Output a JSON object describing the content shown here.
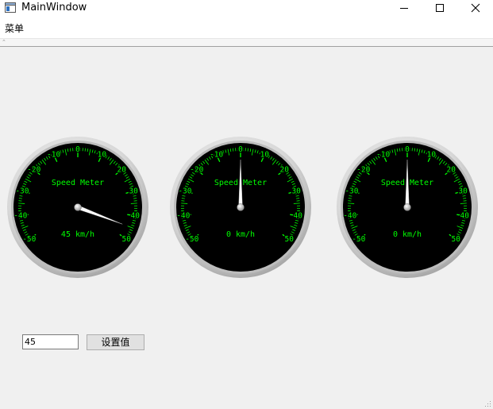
{
  "window": {
    "title": "MainWindow"
  },
  "menu": {
    "items": [
      {
        "label": "菜单"
      }
    ]
  },
  "theme": {
    "dial_face": "#000000",
    "scale_color": "#00ff00",
    "needle_color": "#ffffff"
  },
  "gauge_style": {
    "min": -50,
    "max": 50,
    "start_angle_deg": -123,
    "end_angle_deg": 123,
    "tick_labels": [
      -50,
      -40,
      -30,
      -20,
      -10,
      0,
      10,
      20,
      30,
      40,
      50
    ],
    "label": "Speed Meter",
    "unit": "km/h"
  },
  "gauges": [
    {
      "value": 45,
      "readout": "45 km/h"
    },
    {
      "value": 0,
      "readout": "0 km/h"
    },
    {
      "value": 0,
      "readout": "0 km/h"
    }
  ],
  "controls": {
    "input_value": "45",
    "button_label": "设置值"
  }
}
